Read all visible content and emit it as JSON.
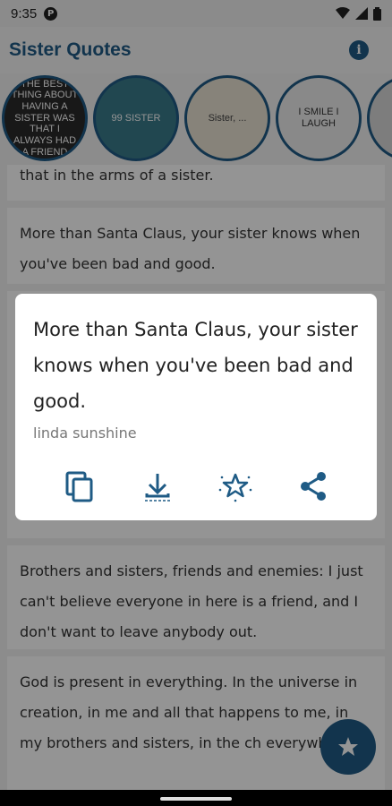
{
  "status": {
    "time": "9:35",
    "notif": "P"
  },
  "appbar": {
    "title": "Sister Quotes"
  },
  "thumbnails": [
    {
      "text": "THE BEST THING ABOUT HAVING A SISTER WAS THAT I ALWAYS HAD A FRIEND",
      "bg": "#2a2a2a",
      "fg": "#ffffff"
    },
    {
      "text": "99 SISTER",
      "bg": "#3a7a8a",
      "fg": "#ffffff"
    },
    {
      "text": "Sister, ...",
      "bg": "#e8e2d3",
      "fg": "#444444"
    },
    {
      "text": "I SMILE I LAUGH",
      "bg": "#ececec",
      "fg": "#333333"
    },
    {
      "text": "",
      "bg": "#d7d7d7",
      "fg": "#333333"
    }
  ],
  "quotes": [
    "that in the arms of a sister.",
    "More than Santa Claus, your sister knows when you've been bad and good.",
    "",
    "Brothers and sisters, friends and enemies: I just can't believe everyone in here is a friend, and I don't want to leave anybody out.",
    "God is present in everything. In the universe in creation, in me and all that happens to me, in my brothers and sisters, in the ch everywhere."
  ],
  "dialog": {
    "quote": "More than Santa Claus, your sister knows when you've been bad and good.",
    "author": "linda sunshine",
    "actions": [
      "copy-icon",
      "download-icon",
      "star-icon",
      "share-icon"
    ]
  },
  "colors": {
    "primary": "#1f5b85"
  }
}
